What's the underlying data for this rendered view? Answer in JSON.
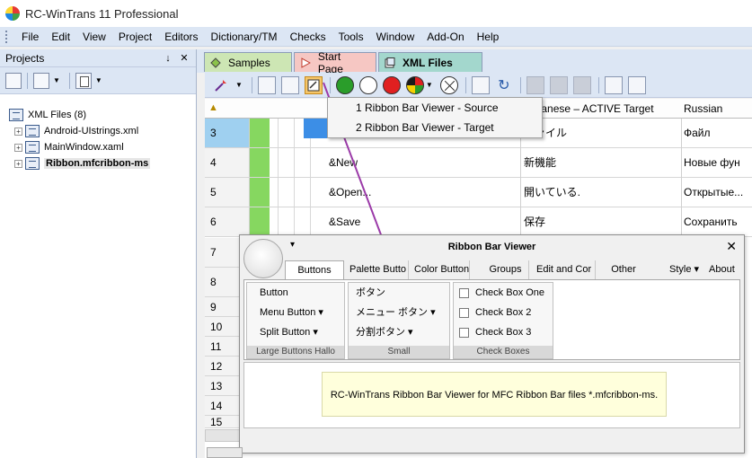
{
  "window": {
    "title": "RC-WinTrans 11 Professional"
  },
  "menu": [
    "File",
    "Edit",
    "View",
    "Project",
    "Editors",
    "Dictionary/TM",
    "Checks",
    "Tools",
    "Window",
    "Add-On",
    "Help"
  ],
  "projects_panel": {
    "title": "Projects",
    "pin": "p",
    "close": "✕",
    "root": "XML Files (8)",
    "items": [
      "Android-UIstrings.xml",
      "MainWindow.xaml",
      "Ribbon.mfcribbon-ms"
    ]
  },
  "doc_tabs": [
    "Samples",
    "Start Page",
    "XML Files"
  ],
  "grid": {
    "header_target": "Japanese – ACTIVE Target",
    "header_russian": "Russian",
    "rows": [
      {
        "n": "3",
        "src": "",
        "tgt": "ファイル",
        "ru": "Файл"
      },
      {
        "n": "4",
        "src": "&New",
        "tgt": "新機能",
        "ru": "Новые фун"
      },
      {
        "n": "5",
        "src": "&Open...",
        "tgt": "開いている.",
        "ru": "Открытые..."
      },
      {
        "n": "6",
        "src": "&Save",
        "tgt": "保存",
        "ru": "Сохранить"
      }
    ],
    "more_rows": [
      "7",
      "8",
      "9",
      "10",
      "11",
      "12",
      "13",
      "14",
      "15"
    ]
  },
  "context_menu": [
    "1 Ribbon Bar Viewer - Source",
    "2 Ribbon Bar Viewer - Target"
  ],
  "viewer": {
    "title": "Ribbon Bar Viewer",
    "close": "✕",
    "qat": "▾",
    "tabs": [
      "Buttons",
      "Palette Butto",
      "Color Button",
      "Groups",
      "Edit and Cor",
      "Other"
    ],
    "style_label": "Style  ▾",
    "about_label": "About",
    "large_group": {
      "items": [
        "Button",
        "Menu Button  ▾",
        "Split Button  ▾"
      ],
      "label": "Large Buttons Hallo"
    },
    "small_group": {
      "items": [
        "ボタン",
        "メニュー ボタン  ▾",
        "分割ボタン  ▾"
      ],
      "label": "Small"
    },
    "check_group": {
      "items": [
        "Check Box One",
        "Check Box 2",
        "Check Box 3"
      ],
      "label": "Check Boxes"
    },
    "note": "RC-WinTrans Ribbon Bar Viewer for MFC Ribbon Bar files *.mfcribbon-ms."
  },
  "colors": {
    "menu_bg": "#dce6f4",
    "status_green": "#86d760",
    "selection_blue": "#3c8ee6",
    "connector": "#9b3aa8"
  }
}
